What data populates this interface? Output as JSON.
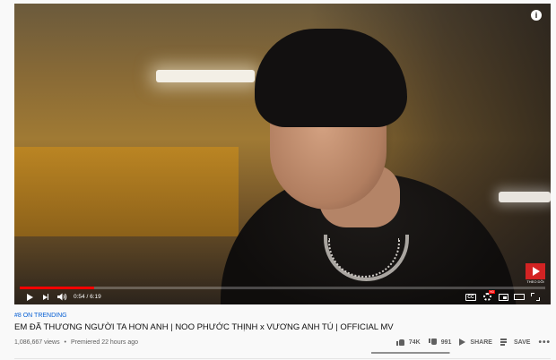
{
  "player": {
    "current_time": "0:54",
    "duration": "6:19",
    "time_separator": " / ",
    "progress_fraction": 0.142,
    "buffered_fraction": 0.14,
    "cc_label": "CC",
    "hd_badge": "HD",
    "info_glyph": "i",
    "watermark_text": "THEO DÕI"
  },
  "video": {
    "hashtag": "#8 ON TRENDING",
    "title": "EM ĐÃ THƯƠNG NGƯỜI TA HƠN ANH | NOO PHƯỚC THỊNH x VƯƠNG ANH TÚ | OFFICIAL MV",
    "views": "1,086,667 views",
    "separator": "•",
    "premiered": "Premiered 22 hours ago"
  },
  "actions": {
    "likes": "74K",
    "dislikes": "991",
    "share_label": "SHARE",
    "save_label": "SAVE",
    "more_glyph": "•••",
    "like_ratio": 0.987
  },
  "colors": {
    "progress": "#ff0000",
    "link": "#065fd4",
    "watermark": "#d32323"
  },
  "icons": [
    "play-icon",
    "next-icon",
    "volume-icon",
    "captions-icon",
    "settings-icon",
    "miniplayer-icon",
    "theater-icon",
    "fullscreen-icon",
    "info-icon",
    "like-icon",
    "dislike-icon",
    "share-icon",
    "save-icon",
    "more-icon"
  ]
}
